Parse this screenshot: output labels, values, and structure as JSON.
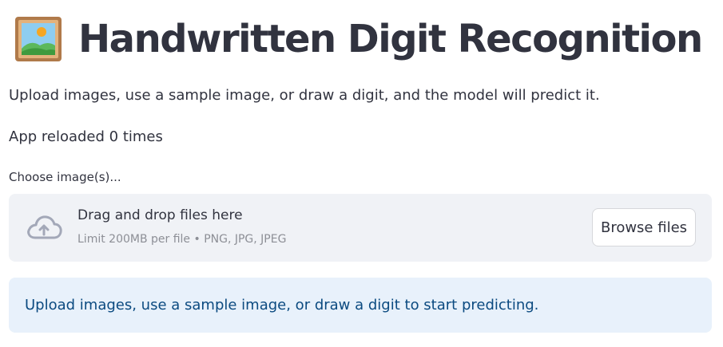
{
  "header": {
    "title": "Handwritten Digit Recognition",
    "icon": "framed-picture-icon"
  },
  "description": "Upload images, use a sample image, or draw a digit, and the model will predict it.",
  "reload_status": "App reloaded 0 times",
  "uploader": {
    "label": "Choose image(s)...",
    "drop_title": "Drag and drop files here",
    "limit_text": "Limit 200MB per file • PNG, JPG, JPEG",
    "browse_label": "Browse files",
    "icon": "cloud-upload-icon"
  },
  "info": {
    "message": "Upload images, use a sample image, or draw a digit to start predicting."
  },
  "colors": {
    "text": "#31333f",
    "dropzone_bg": "#f0f2f6",
    "info_bg": "#e8f1fb",
    "info_text": "#0b4a80",
    "muted": "#8d8f96"
  }
}
